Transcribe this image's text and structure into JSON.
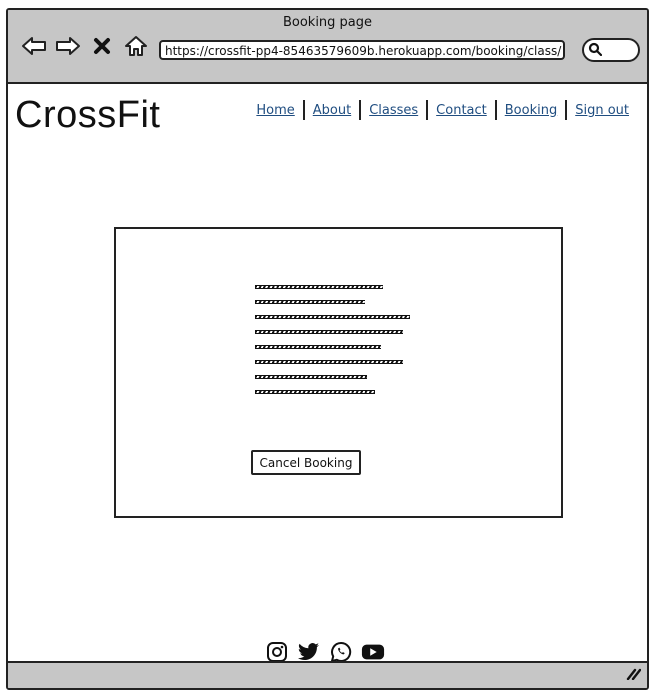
{
  "window": {
    "title": "Booking page"
  },
  "browser": {
    "url": "https://crossfit-pp4-85463579609b.herokuapp.com/booking/class/",
    "icons": [
      "back-icon",
      "forward-icon",
      "close-icon",
      "home-icon",
      "search-icon"
    ]
  },
  "header": {
    "logo": "CrossFit",
    "nav": [
      "Home",
      "About",
      "Classes",
      "Contact",
      "Booking",
      "Sign out"
    ]
  },
  "main": {
    "cancel_label": "Cancel Booking"
  },
  "footer": {
    "social_icons": [
      "instagram-icon",
      "twitter-icon",
      "whatsapp-icon",
      "youtube-icon"
    ]
  },
  "colors": {
    "chrome": "#c6c6c6",
    "link": "#1f4d80",
    "border": "#222222"
  }
}
